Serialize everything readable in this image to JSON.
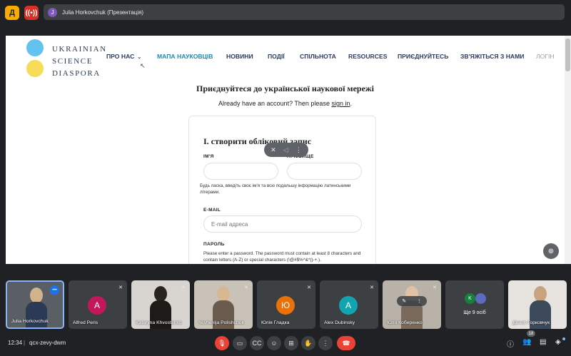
{
  "topbar": {
    "app_icon": "Д",
    "presenting_avatar": "J",
    "presenting_label": "Julia Horkovchuk (Презентація)"
  },
  "site": {
    "logo_lines": [
      "UKRAINIAN",
      "SCIENCE",
      "DIASPORA"
    ],
    "nav": [
      "ПРО НАС",
      "МАПА НАУКОВЦІВ",
      "НОВИНИ",
      "ПОДІЇ",
      "СПІЛЬНОТА",
      "RESOURCES",
      "ПРИЄДНУЙТЕСЬ",
      "ЗВ'ЯЖІТЬСЯ З НАМИ",
      "ЛОГІН"
    ],
    "join_title": "Приєднуйтеся до української наукової мережі",
    "have_account": "Already have an account? Then please",
    "sign_in": "sign in",
    "period": ".",
    "section_title": "I. створити обліковий запис",
    "first_name_label": "ІМ'Я",
    "last_name_label": "ПРІЗВИЩЕ",
    "name_note": "Будь ласка, введіть своє ім'я та всю подальшу інформацію латинськими літерами.",
    "email_label": "E-MAIL",
    "email_placeholder": "E-mail адреса",
    "password_label": "ПАРОЛЬ",
    "password_note": "Please enter a password. The password must contain at least 8 characters and contain letters (A-Z) or special characters (!@#$%^&*()-+.)."
  },
  "participants": [
    {
      "name": "Julia Horkovchuk",
      "type": "video"
    },
    {
      "name": "Alfred Peris",
      "type": "avatar",
      "initial": "A",
      "color": "#c2185b"
    },
    {
      "name": "Kateryna Khvostenko",
      "type": "video"
    },
    {
      "name": "Yevhenija Polishchuk",
      "type": "video"
    },
    {
      "name": "Юлія Гладка",
      "type": "avatar",
      "initial": "Ю",
      "color": "#e8710a"
    },
    {
      "name": "Alex Dubinsky",
      "type": "avatar",
      "initial": "A",
      "color": "#12a4af"
    },
    {
      "name": "Юля Кобиренко",
      "type": "video"
    },
    {
      "name": "Ще 9 осіб",
      "type": "more",
      "initial": "K"
    },
    {
      "name": "Денис Горковчук",
      "type": "video"
    }
  ],
  "bottombar": {
    "time": "12:34",
    "separator": "|",
    "meeting_code": "qcx-zevy-dwm",
    "people_count": "18"
  }
}
